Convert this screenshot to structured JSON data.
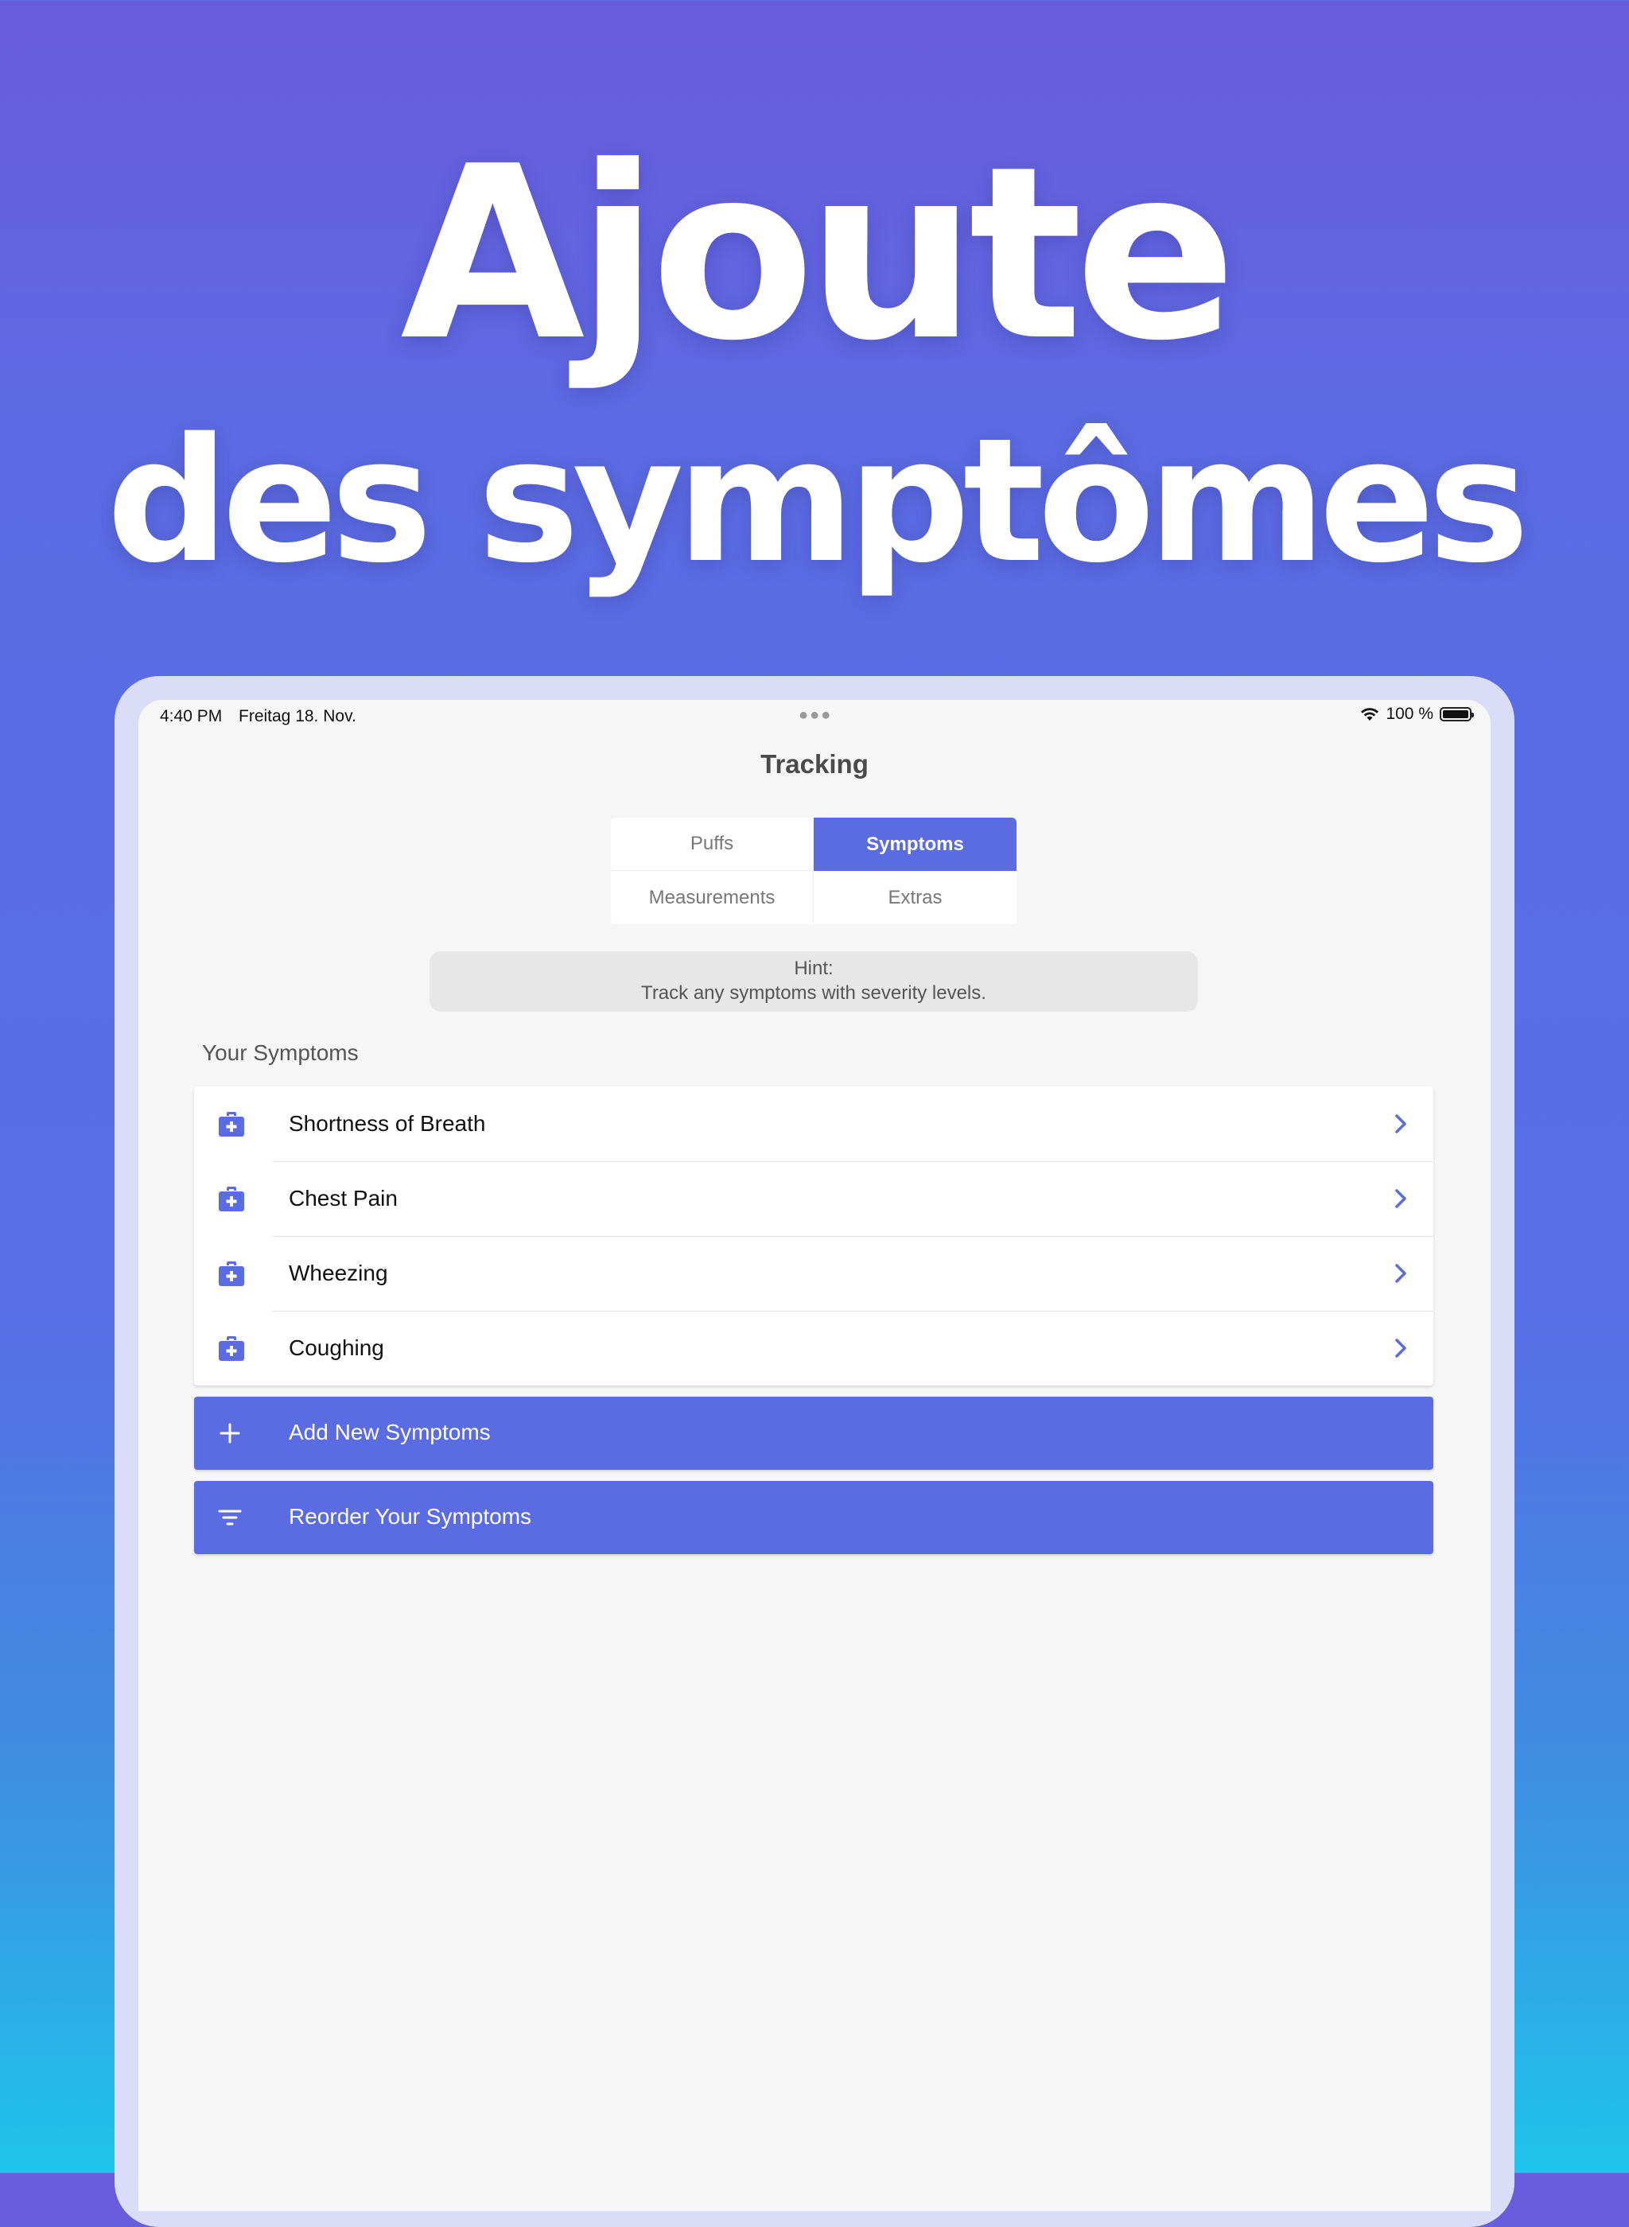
{
  "headline": {
    "line1": "Ajoute",
    "line2": "des symptômes"
  },
  "status_bar": {
    "time": "4:40 PM",
    "date": "Freitag 18. Nov.",
    "battery": "100 %",
    "battery_level": 1.0
  },
  "nav": {
    "title": "Tracking"
  },
  "segments": {
    "puffs": "Puffs",
    "symptoms": "Symptoms",
    "measurements": "Measurements",
    "extras": "Extras",
    "selected": "Symptoms"
  },
  "hint": {
    "title": "Hint:",
    "text": "Track any symptoms with severity levels."
  },
  "symptoms_section": {
    "header": "Your Symptoms",
    "items": [
      {
        "label": "Shortness of Breath",
        "icon": "medical-bag-icon"
      },
      {
        "label": "Chest Pain",
        "icon": "medical-bag-icon"
      },
      {
        "label": "Wheezing",
        "icon": "medical-bag-icon"
      },
      {
        "label": "Coughing",
        "icon": "medical-bag-icon"
      }
    ]
  },
  "actions": {
    "add_label": "Add New Symptoms",
    "add_icon": "plus-icon",
    "reorder_label": "Reorder Your Symptoms",
    "reorder_icon": "sort-icon"
  },
  "colors": {
    "accent": "#5b6ce2",
    "background_top": "#6a5bdc",
    "background_bottom": "#1ec5ea"
  }
}
